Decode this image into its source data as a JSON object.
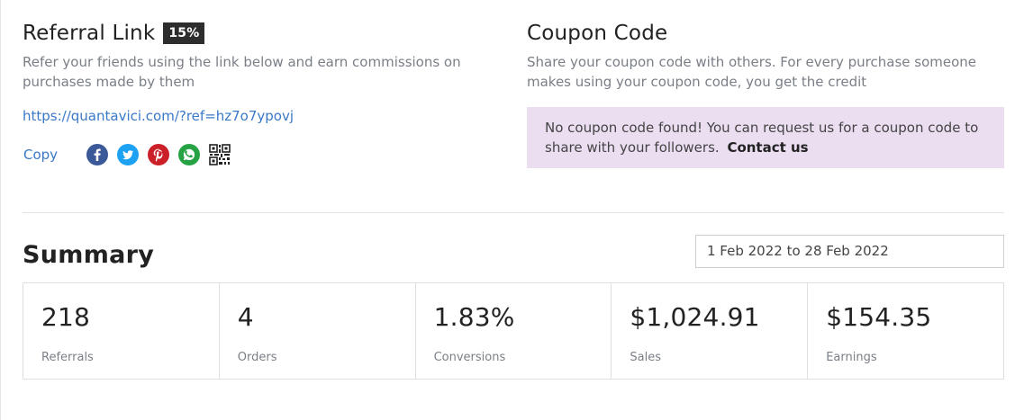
{
  "referral": {
    "title": "Referral Link",
    "badge": "15%",
    "description": "Refer your friends using the link below and earn commissions on purchases made by them",
    "link": "https://quantavici.com/?ref=hz7o7ypovj",
    "copy_label": "Copy",
    "share_icons": [
      "facebook-icon",
      "twitter-icon",
      "pinterest-icon",
      "whatsapp-icon",
      "qr-code-icon"
    ]
  },
  "coupon": {
    "title": "Coupon Code",
    "description": "Share your coupon code with others. For every purchase someone makes using your coupon code, you get the credit",
    "notice_text": "No coupon code found! You can request us for a coupon code to share with your followers.",
    "contact_label": "Contact us"
  },
  "summary": {
    "title": "Summary",
    "date_range": "1 Feb 2022 to 28 Feb 2022",
    "stats": [
      {
        "value": "218",
        "label": "Referrals"
      },
      {
        "value": "4",
        "label": "Orders"
      },
      {
        "value": "1.83%",
        "label": "Conversions"
      },
      {
        "value": "$1,024.91",
        "label": "Sales"
      },
      {
        "value": "$154.35",
        "label": "Earnings"
      }
    ]
  },
  "colors": {
    "facebook": "#3b5998",
    "twitter": "#1da1f2",
    "pinterest": "#cb2027",
    "whatsapp": "#25a244",
    "link": "#3a78c8",
    "notice_bg": "#ebdef1"
  }
}
